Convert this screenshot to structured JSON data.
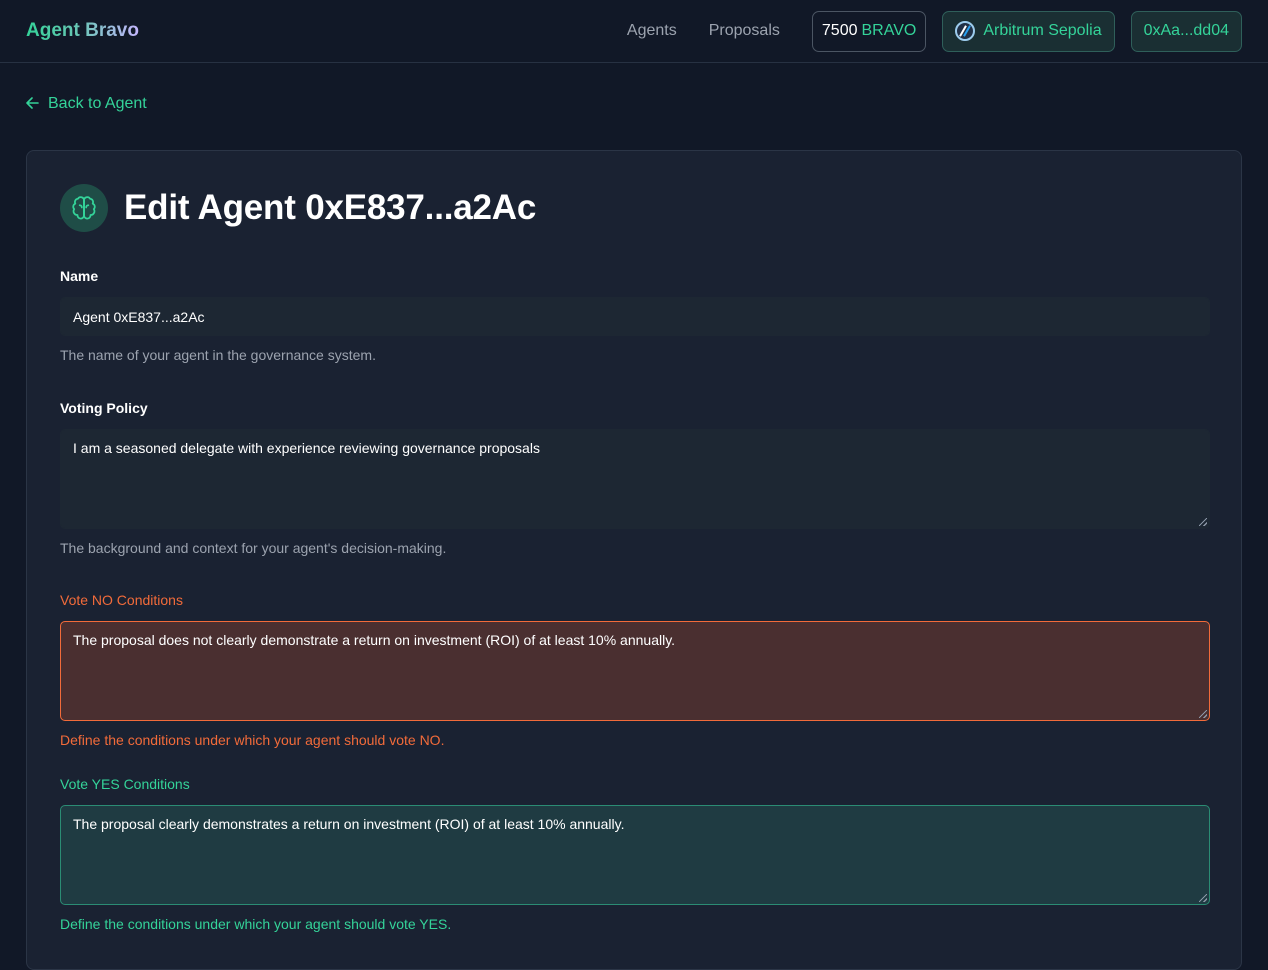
{
  "header": {
    "brand": "Agent Bravo",
    "nav": [
      "Agents",
      "Proposals"
    ],
    "balance_amount": "7500",
    "balance_symbol": "BRAVO",
    "network": "Arbitrum Sepolia",
    "wallet": "0xAa...dd04"
  },
  "back_link": "Back to Agent",
  "page": {
    "title": "Edit Agent 0xE837...a2Ac"
  },
  "form": {
    "name": {
      "label": "Name",
      "value": "Agent 0xE837...a2Ac",
      "help": "The name of your agent in the governance system."
    },
    "voting_policy": {
      "label": "Voting Policy",
      "value": "I am a seasoned delegate with experience reviewing governance proposals",
      "help": "The background and context for your agent's decision-making."
    },
    "vote_no": {
      "label": "Vote NO Conditions",
      "value": "The proposal does not clearly demonstrate a return on investment (ROI) of at least 10% annually.",
      "help": "Define the conditions under which your agent should vote NO."
    },
    "vote_yes": {
      "label": "Vote YES Conditions",
      "value": "The proposal clearly demonstrates a return on investment (ROI) of at least 10% annually.",
      "help": "Define the conditions under which your agent should vote YES."
    }
  },
  "colors": {
    "accent": "#34d399",
    "no": "#f26b3a",
    "background": "#111827",
    "card": "#1a2232"
  }
}
